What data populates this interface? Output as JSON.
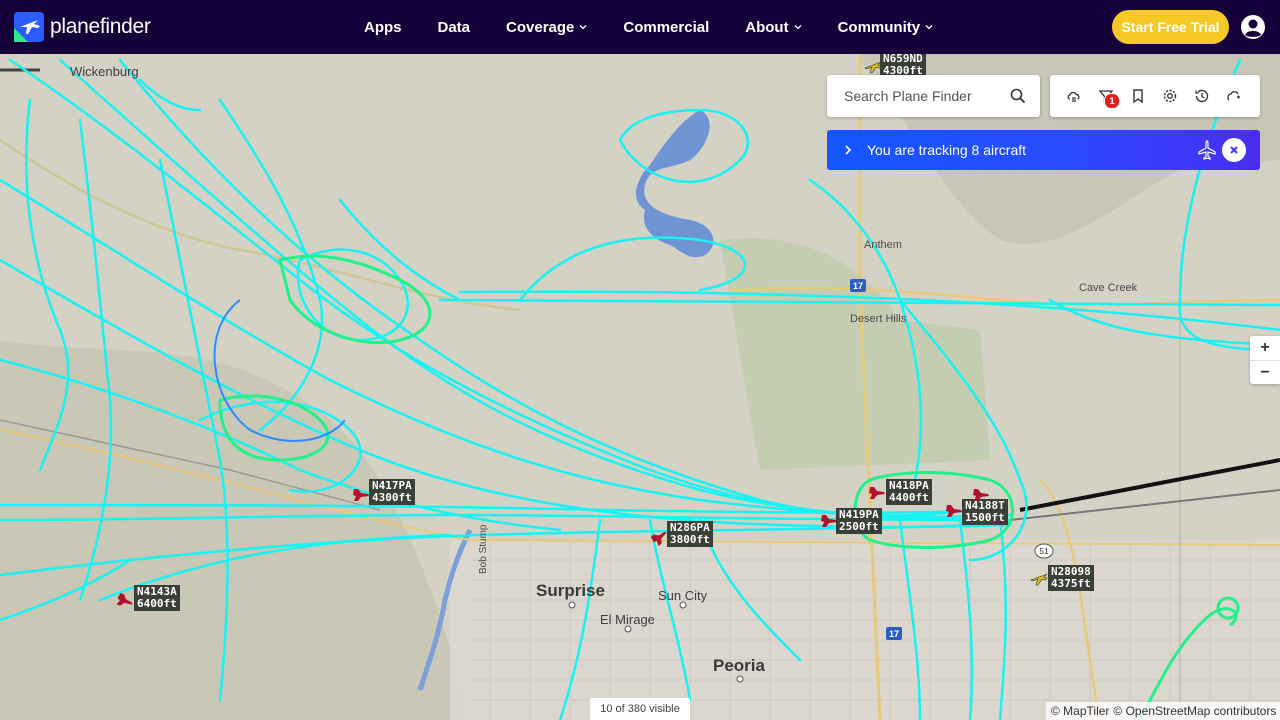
{
  "brand": {
    "name": "planefinder"
  },
  "nav": {
    "items": [
      {
        "label": "Apps",
        "dropdown": false
      },
      {
        "label": "Data",
        "dropdown": false
      },
      {
        "label": "Coverage",
        "dropdown": true
      },
      {
        "label": "Commercial",
        "dropdown": false
      },
      {
        "label": "About",
        "dropdown": true
      },
      {
        "label": "Community",
        "dropdown": true
      }
    ],
    "cta_label": "Start Free Trial"
  },
  "search": {
    "placeholder": "Search Plane Finder"
  },
  "toolbar": {
    "icons": [
      "weather-icon",
      "filter-icon",
      "bookmark-icon",
      "settings-icon",
      "history-icon",
      "layers-icon"
    ],
    "filter_badge": "1"
  },
  "tracking": {
    "text": "You are tracking 8 aircraft"
  },
  "zoom": {
    "in": "+",
    "out": "−"
  },
  "status": {
    "visible_count": "10 of 380 visible"
  },
  "attribution": {
    "maptiler": "© MapTiler",
    "osm": "© OpenStreetMap contributors"
  },
  "places": [
    {
      "name": "Wickenburg",
      "size": "small"
    },
    {
      "name": "Anthem",
      "size": "small"
    },
    {
      "name": "Desert Hills",
      "size": "small"
    },
    {
      "name": "Cave Creek",
      "size": "small"
    },
    {
      "name": "Surprise",
      "size": "big"
    },
    {
      "name": "Sun City",
      "size": "mid"
    },
    {
      "name": "El Mirage",
      "size": "mid"
    },
    {
      "name": "Peoria",
      "size": "big"
    },
    {
      "name": "Bob Stump",
      "size": "small"
    }
  ],
  "highways": [
    "17",
    "17",
    "51"
  ],
  "aircraft": [
    {
      "callsign": "N659ND",
      "altitude": "4300ft",
      "color": "#d9c21a"
    },
    {
      "callsign": "N417PA",
      "altitude": "4300ft",
      "color": "#b3122a"
    },
    {
      "callsign": "N418PA",
      "altitude": "4400ft",
      "color": "#b3122a"
    },
    {
      "callsign": "N419PA",
      "altitude": "2500ft",
      "color": "#b3122a"
    },
    {
      "callsign": "N4188T",
      "altitude": "1500ft",
      "color": "#b3122a"
    },
    {
      "callsign": "N286PA",
      "altitude": "3800ft",
      "color": "#b3122a"
    },
    {
      "callsign": "N28098",
      "altitude": "4375ft",
      "color": "#d9c21a"
    },
    {
      "callsign": "N4143A",
      "altitude": "6400ft",
      "color": "#b3122a"
    }
  ],
  "colors": {
    "navbar": "#16003a",
    "cta": "#f7c928",
    "track": "#19f2f2",
    "track_low": "#22f08a",
    "banner_start": "#1456ff",
    "banner_end": "#4a2df2"
  }
}
